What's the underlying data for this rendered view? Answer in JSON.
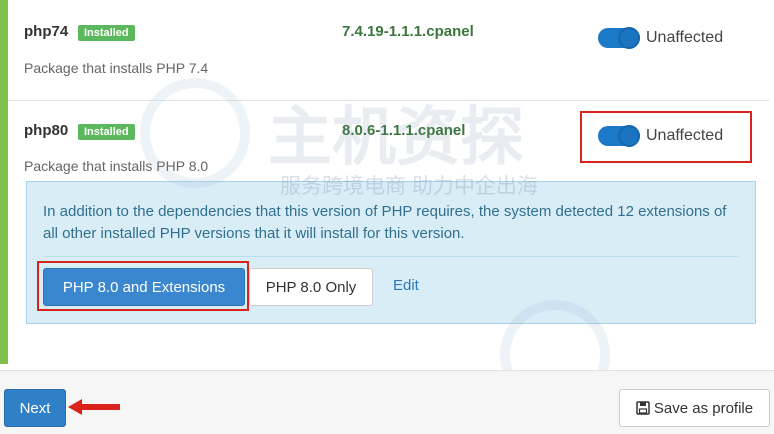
{
  "packages": [
    {
      "name": "php74",
      "badge": "Installed",
      "version": "7.4.19-1.1.1.cpanel",
      "description": "Package that installs PHP 7.4",
      "toggle_label": "Unaffected",
      "toggle_state": "on"
    },
    {
      "name": "php80",
      "badge": "Installed",
      "version": "8.0.6-1.1.1.cpanel",
      "description": "Package that installs PHP 8.0",
      "toggle_label": "Unaffected",
      "toggle_state": "on"
    }
  ],
  "info_panel": {
    "message": "In addition to the dependencies that this version of PHP requires, the system detected 12 extensions of all other installed PHP versions that it will install for this version.",
    "primary_button": "PHP 8.0 and Extensions",
    "secondary_button": "PHP 8.0 Only",
    "edit_link": "Edit"
  },
  "footer": {
    "next_button": "Next",
    "save_profile_button": "Save as profile"
  },
  "watermark": {
    "brand_text": "主机资探",
    "slogan_text": "服务跨境电商 助力中企出海"
  },
  "colors": {
    "accent": "#3a87cf",
    "success": "#5cb85c",
    "version_text": "#3c763d",
    "highlight": "#d9231d",
    "info_bg": "#d9edf7"
  },
  "icons": {
    "save": "floppy-disk-icon",
    "arrow": "red-arrow-left-icon"
  }
}
